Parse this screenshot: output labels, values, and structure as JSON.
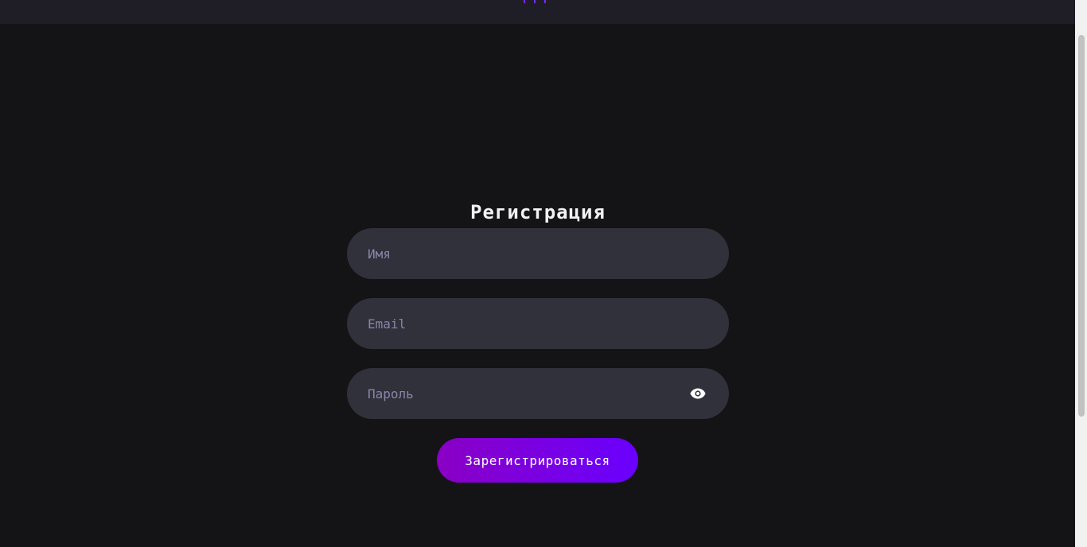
{
  "header": {
    "logo_icon": "globe-logo-icon",
    "accent_color": "#6a00ff"
  },
  "form": {
    "title": "Регистрация",
    "name_placeholder": "Имя",
    "email_placeholder": "Email",
    "password_placeholder": "Пароль",
    "password_toggle_icon": "eye-icon",
    "submit_label": "Зарегистрироваться",
    "submit_gradient": [
      "#8a00c4",
      "#6a00ff"
    ],
    "field_background": "#31313b",
    "placeholder_color": "#8b84a8"
  },
  "colors": {
    "page_background": "#141416",
    "topbar_background": "#1f1e26"
  }
}
